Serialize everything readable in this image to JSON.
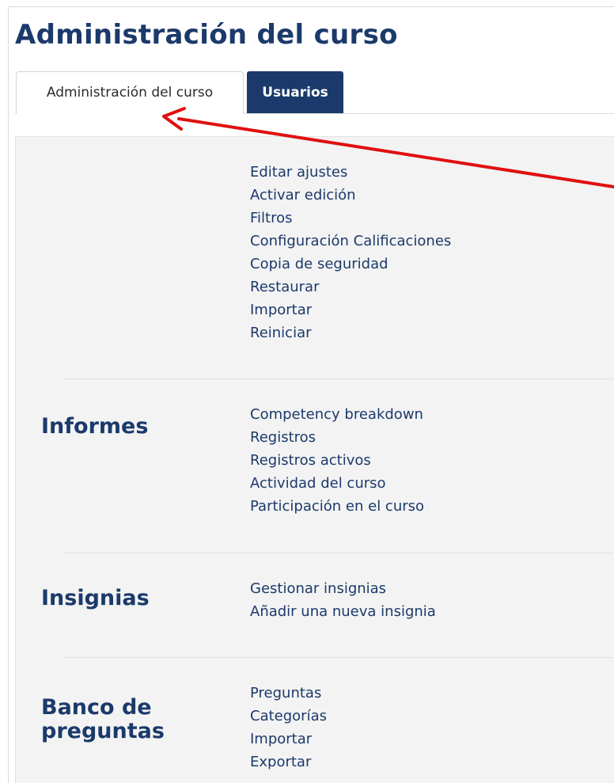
{
  "page_title": "Administración del curso",
  "tabs": [
    {
      "label": "Administración del curso",
      "active": true
    },
    {
      "label": "Usuarios",
      "active": false
    }
  ],
  "sections": [
    {
      "heading": "",
      "links": [
        "Editar ajustes",
        "Activar edición",
        "Filtros",
        "Configuración Calificaciones",
        "Copia de seguridad",
        "Restaurar",
        "Importar",
        "Reiniciar"
      ]
    },
    {
      "heading": "Informes",
      "links": [
        "Competency breakdown",
        "Registros",
        "Registros activos",
        "Actividad del curso",
        "Participación en el curso"
      ]
    },
    {
      "heading": "Insignias",
      "links": [
        "Gestionar insignias",
        "Añadir una nueva insignia"
      ]
    },
    {
      "heading": "Banco de preguntas",
      "links": [
        "Preguntas",
        "Categorías",
        "Importar",
        "Exportar"
      ]
    }
  ],
  "colors": {
    "brand_navy": "#1b3a6b",
    "panel_bg": "#f3f3f3",
    "annotation_red": "#e01010"
  },
  "annotation": {
    "icon": "red-arrow-icon"
  }
}
